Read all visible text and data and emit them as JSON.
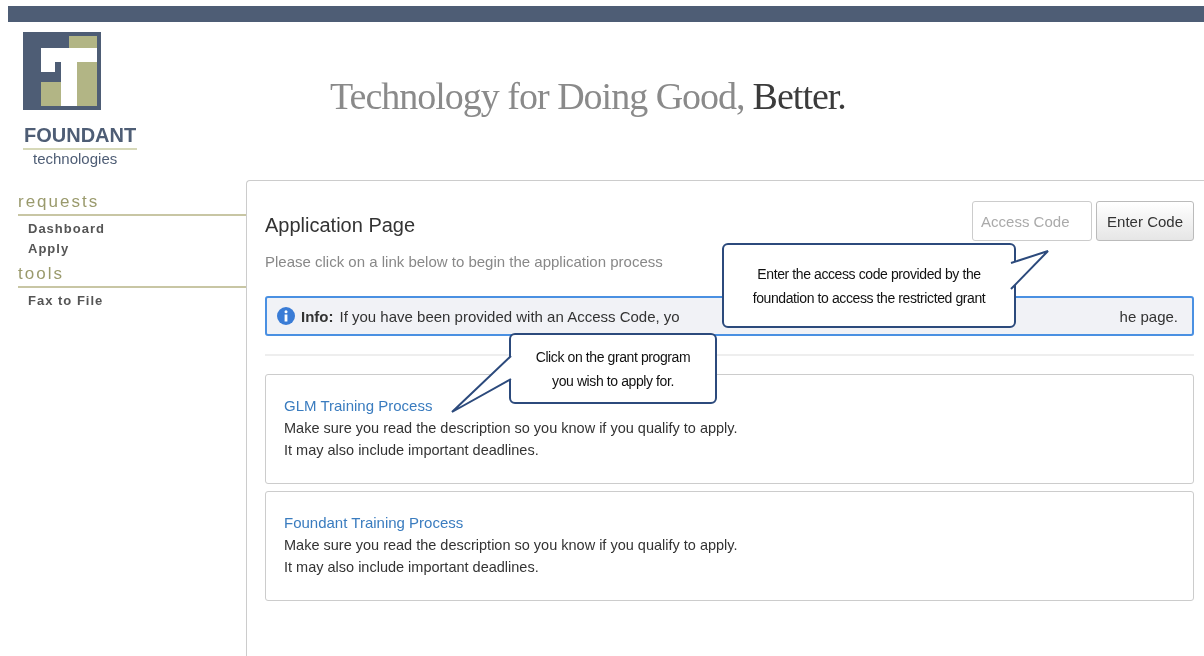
{
  "brand": {
    "name": "FOUNDANT",
    "subtitle": "technologies"
  },
  "tagline": {
    "main": "Technology for Doing Good,",
    "accent": "Better."
  },
  "sidebar": {
    "sections": [
      {
        "title": "requests",
        "items": [
          {
            "label": "Dashboard"
          },
          {
            "label": "Apply"
          }
        ]
      },
      {
        "title": "tools",
        "items": [
          {
            "label": "Fax to File"
          }
        ]
      }
    ]
  },
  "page": {
    "title": "Application Page",
    "access_code": {
      "placeholder": "Access Code"
    },
    "button": "Enter Code",
    "intro": "Please click on a link below to begin the application process",
    "info": {
      "label": "Info:",
      "text_before": "If you have been provided with an Access Code, yo",
      "text_after": "he page."
    },
    "programs": [
      {
        "title": "GLM Training Process",
        "lines": [
          "Make sure you read the description so you know if you qualify to apply.",
          "It may also include important deadlines."
        ]
      },
      {
        "title": "Foundant Training Process",
        "lines": [
          "Make sure you read the description so you know if you qualify to apply.",
          "It may also include important deadlines."
        ]
      }
    ]
  },
  "callouts": [
    {
      "text": "Enter the access code provided by the foundation to access the restricted grant",
      "kind": "right"
    },
    {
      "text": "Click on the grant program you wish to apply for.",
      "kind": "left"
    }
  ]
}
